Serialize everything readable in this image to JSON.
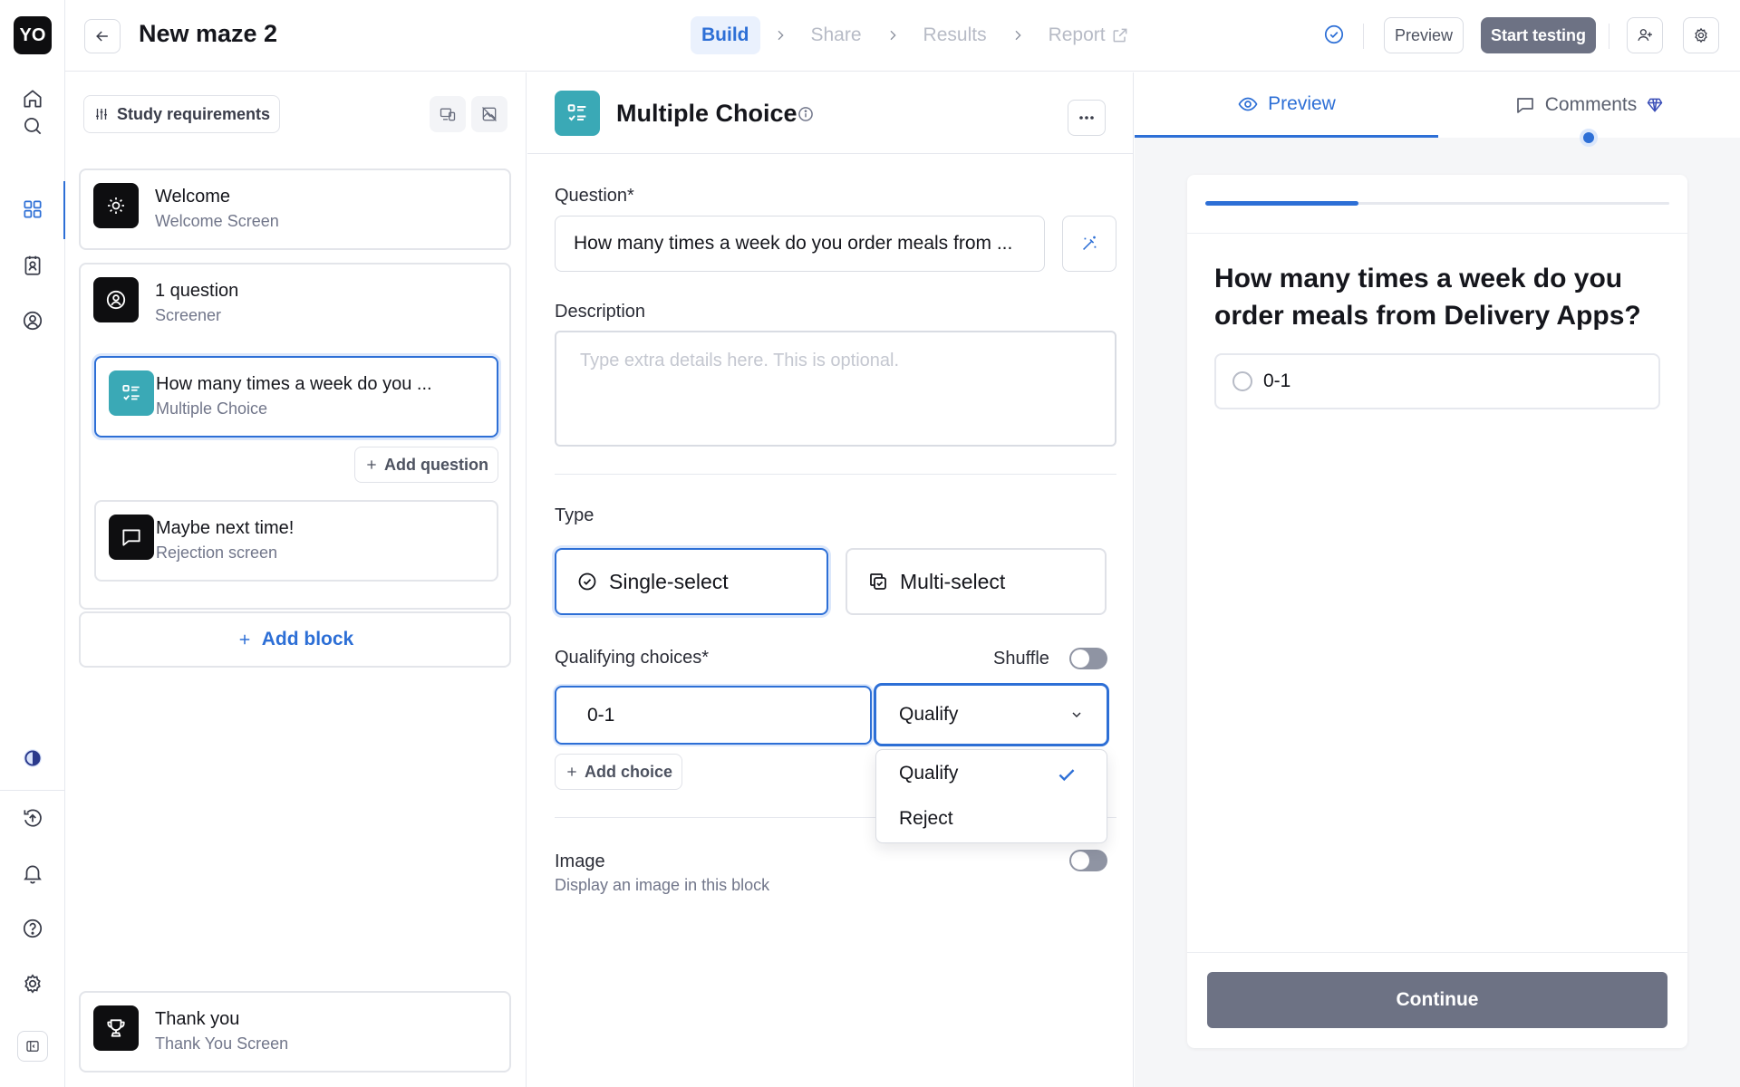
{
  "app": {
    "logo": "YO"
  },
  "header": {
    "title": "New maze 2",
    "steps": [
      "Build",
      "Share",
      "Results",
      "Report"
    ],
    "active_step": "Build",
    "preview_label": "Preview",
    "start_label": "Start testing"
  },
  "left_panel": {
    "requirements_label": "Study requirements",
    "blocks": [
      {
        "title": "Welcome",
        "subtitle": "Welcome Screen",
        "icon": "sun-icon"
      },
      {
        "title": "1 question",
        "subtitle": "Screener",
        "icon": "screener-icon"
      },
      {
        "title": "How many times a week do you ...",
        "subtitle": "Multiple Choice",
        "icon": "list-check-icon"
      },
      {
        "title": "Maybe next time!",
        "subtitle": "Rejection screen",
        "icon": "message-icon"
      },
      {
        "title": "Thank you",
        "subtitle": "Thank You Screen",
        "icon": "trophy-icon"
      }
    ],
    "add_question_label": "Add question",
    "add_block_label": "Add block"
  },
  "editor": {
    "block_type": "Multiple Choice",
    "question_label": "Question*",
    "question_value": "How many times a week do you order meals from ...",
    "description_label": "Description",
    "description_placeholder": "Type extra details here. This is optional.",
    "type_label": "Type",
    "type_options": [
      "Single-select",
      "Multi-select"
    ],
    "selected_type": "Single-select",
    "qualifying_label": "Qualifying choices*",
    "shuffle_label": "Shuffle",
    "shuffle_on": false,
    "choice_value": "0-1",
    "choice_action": "Qualify",
    "dropdown_options": [
      "Qualify",
      "Reject"
    ],
    "add_choice_label": "Add choice",
    "image_label": "Image",
    "image_sub": "Display an image in this block",
    "image_on": false
  },
  "preview": {
    "tabs": [
      "Preview",
      "Comments"
    ],
    "active_tab": "Preview",
    "progress": 0.33,
    "question": "How many times a week do you order meals from Delivery Apps?",
    "option": "0-1",
    "continue_label": "Continue"
  },
  "colors": {
    "accent": "#2d6fd6",
    "teal": "#3aa9b6",
    "button_gray": "#6d7284"
  }
}
